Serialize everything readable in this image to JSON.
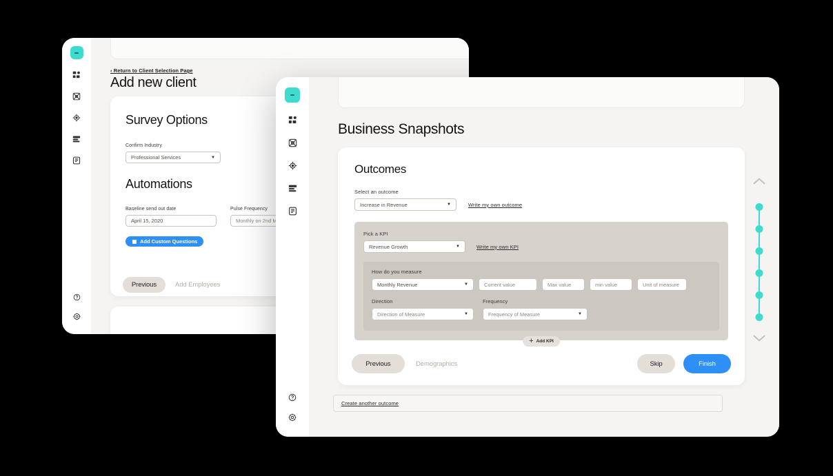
{
  "theme": {
    "teal": "#3ddbd0",
    "blue": "#2e8ff7",
    "panel_warm": "#d8d2cc",
    "panel_warm_dark": "#cdc7c1",
    "page_bg": "#f5f4f2",
    "pill_grey": "#e3ded8"
  },
  "back_window": {
    "breadcrumb": "‹ Return to Client Selection Page",
    "title": "Add new client",
    "card": {
      "heading": "Survey Options",
      "industry_label": "Confirm Industry",
      "industry_value": "Professional Services",
      "automations_heading": "Automations",
      "baseline_label": "Baseline send out date",
      "baseline_value": "April 15, 2020",
      "pulse_label": "Pulse Frequency",
      "pulse_value": "Monthly on 2nd M",
      "add_questions_label": "Add Custom Questions",
      "previous_label": "Previous",
      "next_step_label": "Add Employees"
    },
    "sidebar": {
      "logo_name": "app-logo",
      "items": [
        {
          "name": "dashboard-icon"
        },
        {
          "name": "network-icon"
        },
        {
          "name": "target-icon"
        },
        {
          "name": "layers-icon"
        },
        {
          "name": "document-icon"
        }
      ],
      "bottom": [
        {
          "name": "help-icon"
        },
        {
          "name": "settings-icon"
        }
      ]
    }
  },
  "front_window": {
    "title": "Business Snapshots",
    "outcomes": {
      "heading": "Outcomes",
      "select_outcome_label": "Select an outcome",
      "select_outcome_value": "Increase in Revenue",
      "write_own_outcome_link": "Write my own outcome",
      "kpi": {
        "pick_kpi_label": "Pick a KPI",
        "pick_kpi_value": "Revenue Growth",
        "write_own_kpi_link": "Write my own KPI",
        "measure_label": "How do you measure",
        "measure_value": "Monthly Revenue",
        "current_value_placeholder": "Current value",
        "max_value_placeholder": "Max value",
        "min_value_placeholder": "min value",
        "unit_placeholder": "Unit of measure",
        "direction_label": "Direction",
        "direction_value": "Direction of Measure",
        "frequency_label": "Frequency",
        "frequency_value": "Frequency of Measure"
      },
      "add_kpi_label": "Add KPI"
    },
    "footer": {
      "previous_label": "Previous",
      "next_step_label": "Demographics",
      "skip_label": "Skip",
      "finish_label": "Finish"
    },
    "create_another_link": "Create another outcome",
    "sidebar": {
      "logo_name": "app-logo",
      "items": [
        {
          "name": "dashboard-icon"
        },
        {
          "name": "network-icon"
        },
        {
          "name": "target-icon"
        },
        {
          "name": "layers-icon"
        },
        {
          "name": "document-icon"
        }
      ],
      "bottom": [
        {
          "name": "help-icon"
        },
        {
          "name": "settings-icon"
        }
      ]
    }
  },
  "right_rail": {
    "scroll_up_name": "chevron-up-icon",
    "scroll_down_name": "chevron-down-icon",
    "step_count": 6
  }
}
